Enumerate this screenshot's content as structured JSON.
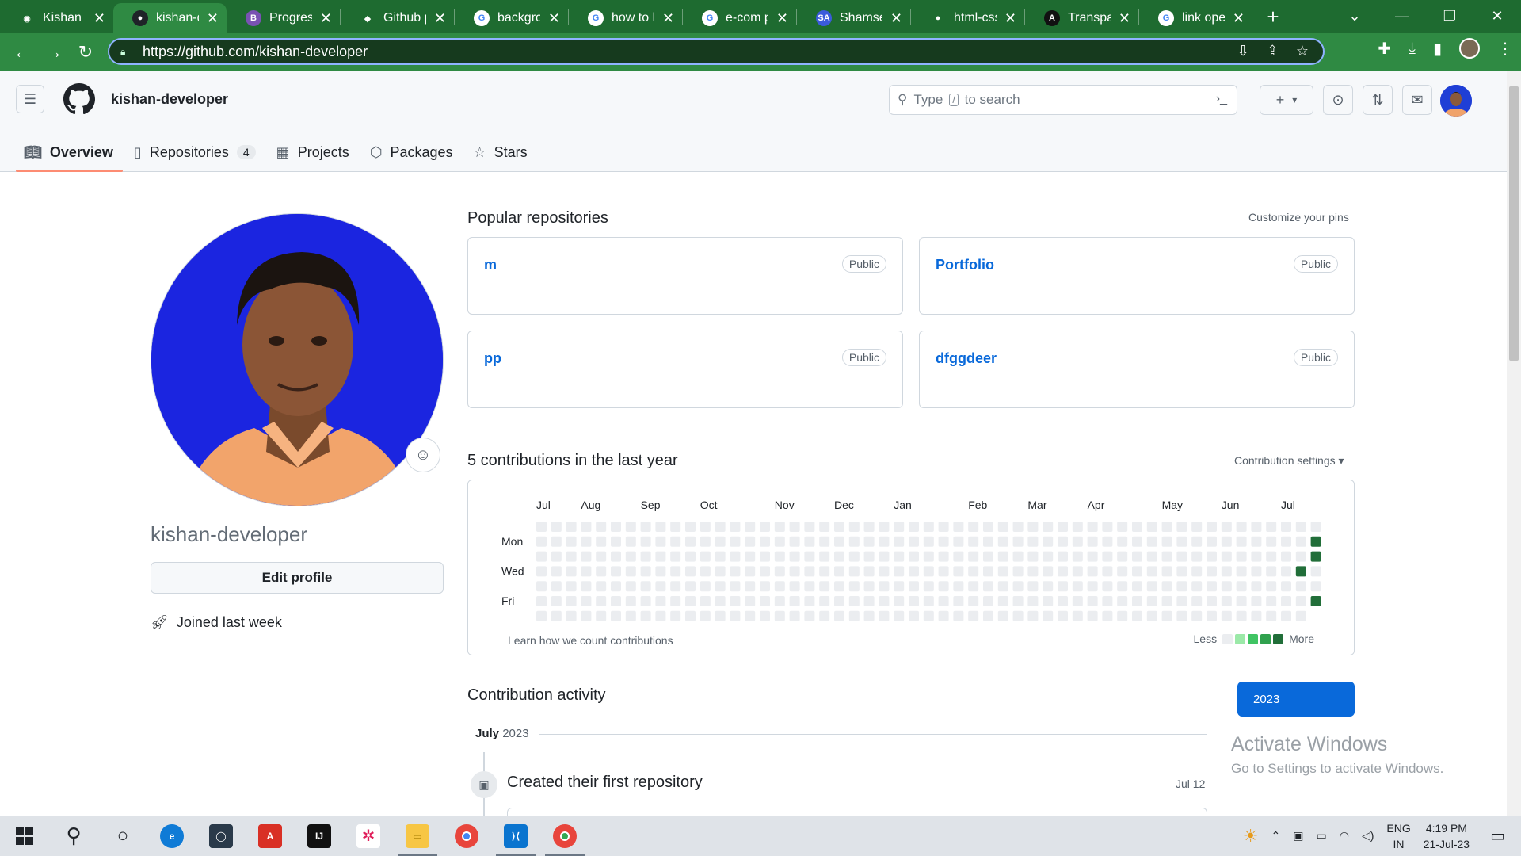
{
  "browser": {
    "tabs": [
      {
        "title": "Kishan",
        "fav_color": "#1e6b30",
        "fav_glyph": "◉"
      },
      {
        "title": "kishan-developer",
        "fav_color": "#1f2328",
        "fav_glyph": "●",
        "active": true
      },
      {
        "title": "Progress",
        "fav_color": "#7952b3",
        "fav_glyph": "B"
      },
      {
        "title": "Github pr",
        "fav_color": "#1e6b30",
        "fav_glyph": "◆"
      },
      {
        "title": "backgrou",
        "fav_color": "#ffffff",
        "fav_glyph": "G"
      },
      {
        "title": "how to lin",
        "fav_color": "#ffffff",
        "fav_glyph": "G"
      },
      {
        "title": "e-com pr",
        "fav_color": "#ffffff",
        "fav_glyph": "G"
      },
      {
        "title": "Shamseer",
        "fav_color": "#3b5bdb",
        "fav_glyph": "SA"
      },
      {
        "title": "html-css-",
        "fav_color": "#1e6b30",
        "fav_glyph": "●"
      },
      {
        "title": "Transpare",
        "fav_color": "#111111",
        "fav_glyph": "A"
      },
      {
        "title": "link open",
        "fav_color": "#ffffff",
        "fav_glyph": "G"
      }
    ],
    "url": "https://github.com/kishan-developer",
    "theme_color": "#2f8a43"
  },
  "header": {
    "context_name": "kishan-developer",
    "search_prefix": "Type",
    "search_key": "/",
    "search_suffix": "to search"
  },
  "nav": {
    "tabs": [
      {
        "label": "Overview",
        "icon": "book-icon",
        "selected": true
      },
      {
        "label": "Repositories",
        "icon": "repo-icon",
        "count": "4"
      },
      {
        "label": "Projects",
        "icon": "table-icon"
      },
      {
        "label": "Packages",
        "icon": "package-icon"
      },
      {
        "label": "Stars",
        "icon": "star-icon"
      }
    ]
  },
  "profile": {
    "username": "kishan-developer",
    "edit_label": "Edit profile",
    "joined": "Joined last week"
  },
  "popular": {
    "heading": "Popular repositories",
    "customize": "Customize your pins",
    "repos": [
      {
        "name": "m",
        "visibility": "Public"
      },
      {
        "name": "Portfolio",
        "visibility": "Public"
      },
      {
        "name": "pp",
        "visibility": "Public"
      },
      {
        "name": "dfggdeer",
        "visibility": "Public"
      }
    ]
  },
  "contributions": {
    "heading": "5 contributions in the last year",
    "settings": "Contribution settings ▾",
    "months": [
      "Jul",
      "Aug",
      "Sep",
      "Oct",
      "Nov",
      "Dec",
      "Jan",
      "Feb",
      "Mar",
      "Apr",
      "May",
      "Jun",
      "Jul"
    ],
    "month_week_index": [
      0,
      3,
      7,
      11,
      16,
      20,
      24,
      29,
      33,
      37,
      42,
      46,
      50
    ],
    "weekdays": [
      "Mon",
      "Wed",
      "Fri"
    ],
    "weeks": 53,
    "active_cells": [
      {
        "week": 52,
        "day": 1
      },
      {
        "week": 52,
        "day": 2
      },
      {
        "week": 51,
        "day": 3
      },
      {
        "week": 52,
        "day": 5
      }
    ],
    "partial_last_week_days": 6,
    "learn": "Learn how we count contributions",
    "legend_less": "Less",
    "legend_more": "More",
    "colors": {
      "empty": "#ebedf0",
      "l1": "#9be9a8",
      "l2": "#40c463",
      "l3": "#30a14e",
      "l4": "#216e39"
    }
  },
  "activity": {
    "heading": "Contribution activity",
    "year_button": "2023",
    "month_label": "July",
    "month_year": "2023",
    "event_title": "Created their first repository",
    "event_date": "Jul 12"
  },
  "watermark": {
    "line1": "Activate Windows",
    "line2": "Go to Settings to activate Windows."
  },
  "taskbar": {
    "lang1": "ENG",
    "lang2": "IN",
    "time": "4:19 PM",
    "date": "21-Jul-23"
  }
}
